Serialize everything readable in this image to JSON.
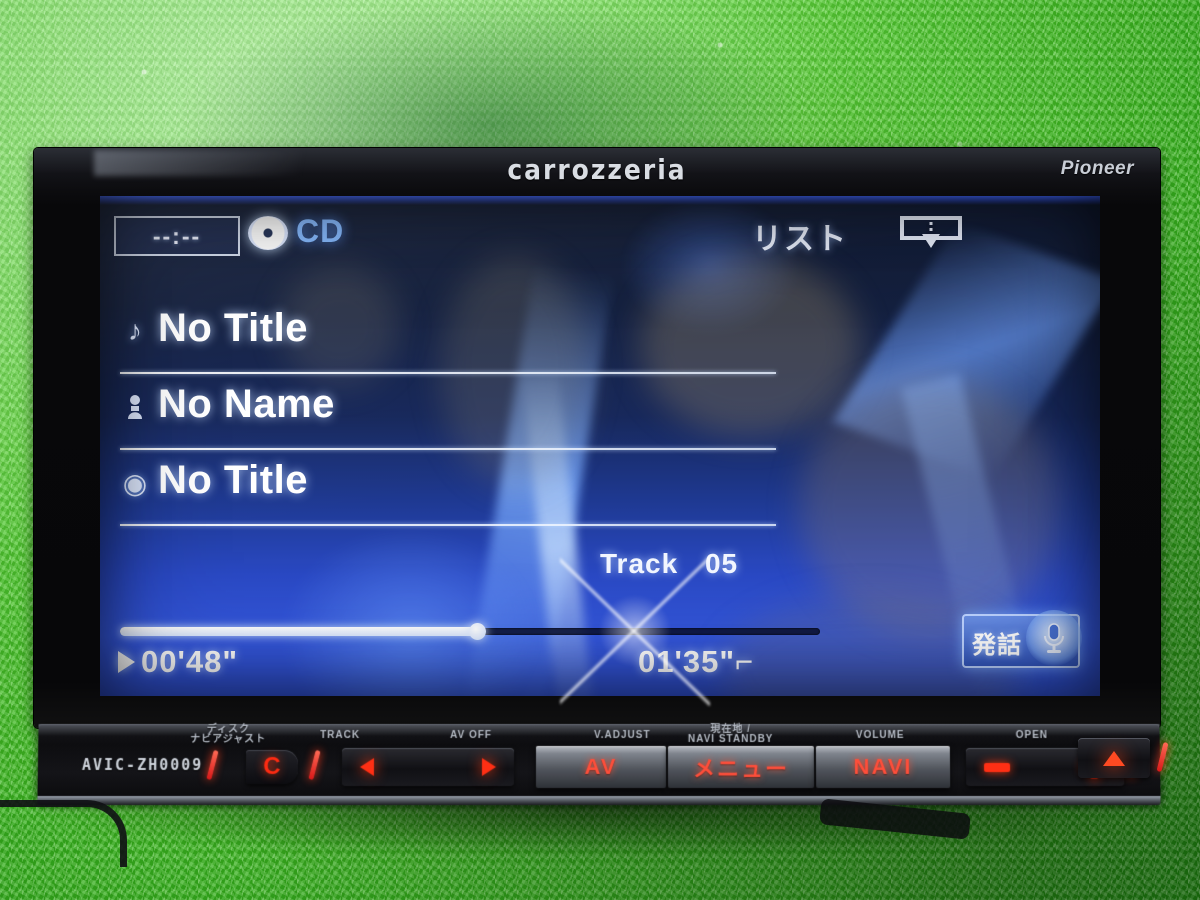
{
  "device": {
    "brand_center": "carrozzeria",
    "brand_right": "Pioneer",
    "model": "AVIC-ZH0009"
  },
  "screen": {
    "status_bar": {
      "clock": "--:--",
      "source_icon": "cd-disc-icon",
      "source_label": "CD",
      "list_button": "リスト",
      "hide_button_icon": "screen-hide-icon"
    },
    "info_rows": [
      {
        "icon": "music-note-icon",
        "icon_glyph": "♪",
        "text": "No Title"
      },
      {
        "icon": "artist-person-icon",
        "icon_glyph": "♟",
        "text": "No Name"
      },
      {
        "icon": "album-disc-icon",
        "icon_glyph": "◉",
        "text": "No Title"
      }
    ],
    "track": {
      "label": "Track",
      "number": "05"
    },
    "playback": {
      "play_icon": "play-triangle-icon",
      "elapsed": "00'48\"",
      "total": "01'35\"⌐",
      "progress_percent": 51
    },
    "talk_button": {
      "label": "発話",
      "icon": "microphone-icon"
    },
    "bluetooth_icon_glyph": "ᛦ"
  },
  "control_panel": {
    "labels": [
      {
        "name": "disc-label",
        "text": "ディスク",
        "text2": "ナビアジャスト"
      },
      {
        "name": "track-label",
        "text": "TRACK"
      },
      {
        "name": "av-off-label",
        "text": "AV OFF"
      },
      {
        "name": "v-adjust-label",
        "text": "V.ADJUST"
      },
      {
        "name": "navi-standby-label",
        "text": "NAVI STANDBY",
        "text2": "現在地 /"
      },
      {
        "name": "volume-label",
        "text": "VOLUME"
      },
      {
        "name": "open-label",
        "text": "OPEN"
      }
    ],
    "buttons": {
      "c_button": "C",
      "track_prev_icon": "track-previous-icon",
      "track_next_icon": "track-next-icon",
      "av": "AV",
      "menu": "メニュー",
      "navi": "NAVI",
      "volume_down_icon": "volume-minus-icon",
      "volume_up_icon": "volume-plus-icon",
      "eject_icon": "eject-icon"
    }
  },
  "colors": {
    "accent_blue": "#3457dd",
    "screen_text": "#ffffff",
    "button_red": "#ff2f14",
    "carpet_green": "#4cc62e"
  }
}
